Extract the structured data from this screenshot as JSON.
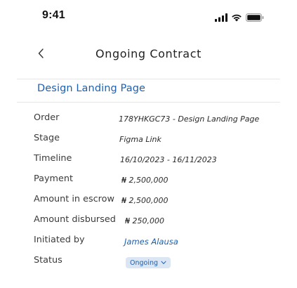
{
  "status_bar": {
    "time": "9:41"
  },
  "header": {
    "title": "Ongoing Contract"
  },
  "project": {
    "name": "Design Landing Page"
  },
  "details": [
    {
      "label": "Order",
      "value": "178YHKGC73 - Design Landing Page"
    },
    {
      "label": "Stage",
      "value": "Figma Link"
    },
    {
      "label": "Timeline",
      "value": "16/10/2023 - 16/11/2023"
    },
    {
      "label": "Payment",
      "value": "₦ 2,500,000"
    },
    {
      "label": "Amount in escrow",
      "value": "₦ 2,500,000"
    },
    {
      "label": "Amount disbursed",
      "value": "₦ 250,000"
    },
    {
      "label": "Initiated by",
      "value": "James Alausa"
    },
    {
      "label": "Status",
      "value": "Ongoing"
    }
  ],
  "colors": {
    "accent": "#1f5fae",
    "badge_bg": "#dbe6f5"
  },
  "icons": {
    "back": "chevron-left-icon",
    "status_dropdown": "chevron-down-icon"
  }
}
